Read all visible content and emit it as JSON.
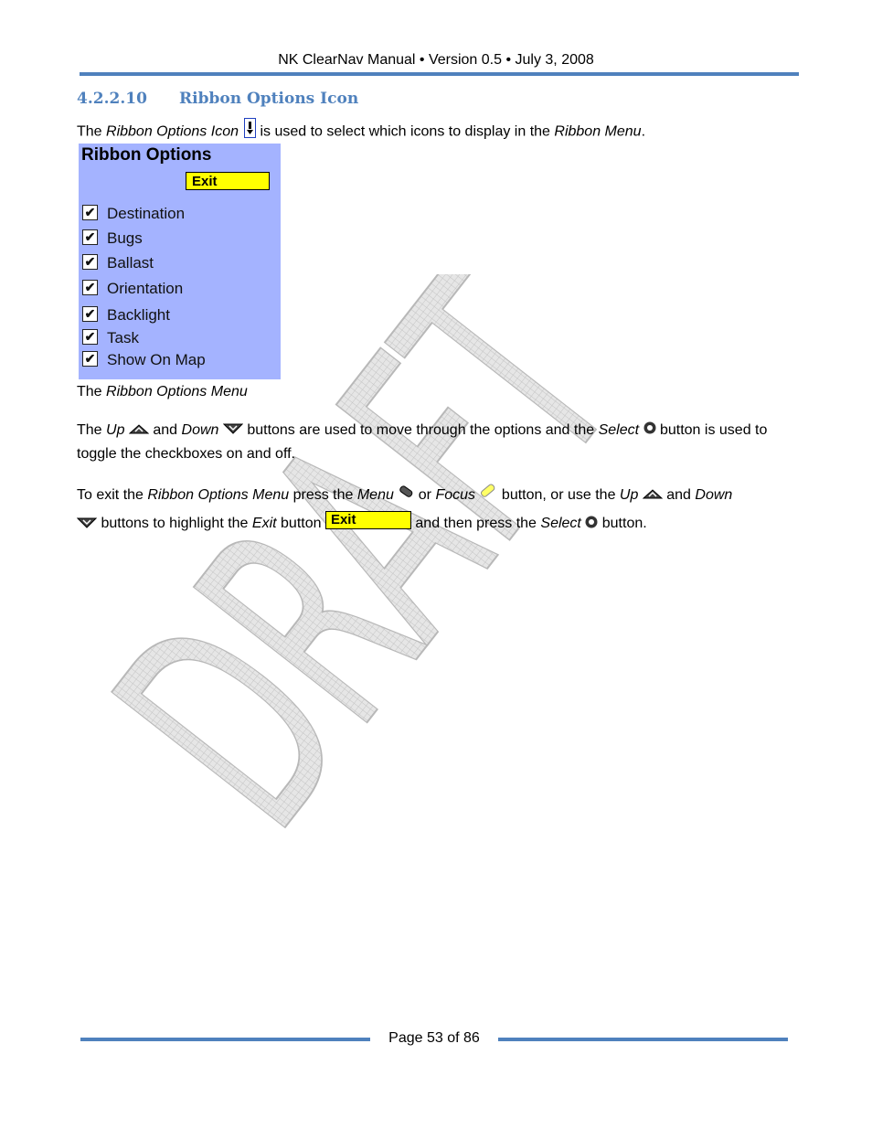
{
  "header": {
    "title": "NK ClearNav Manual • Version 0.5 • July 3, 2008"
  },
  "section": {
    "number": "4.2.2.10",
    "title": "Ribbon Options Icon"
  },
  "intro": {
    "t1": "The ",
    "i1": "Ribbon Options Icon",
    "t2": " is used to select which icons to display in the ",
    "i2": "Ribbon Menu",
    "t3": "."
  },
  "ribbon_panel": {
    "title": "Ribbon Options",
    "exit_label": "Exit",
    "options": [
      {
        "label": "Destination",
        "checked": true
      },
      {
        "label": "Bugs",
        "checked": true
      },
      {
        "label": "Ballast",
        "checked": true
      },
      {
        "label": "Orientation",
        "checked": true
      },
      {
        "label": "Backlight",
        "checked": true
      },
      {
        "label": "Task",
        "checked": true
      },
      {
        "label": "Show On Map",
        "checked": true
      }
    ],
    "check_glyph": "✔",
    "bg_color": "#a4b3ff"
  },
  "caption": {
    "t1": "The ",
    "i1": "Ribbon Options Menu"
  },
  "para1": {
    "t1": "The ",
    "i1": "Up",
    "t2": " and ",
    "i2": "Down",
    "t3": " buttons are used to move through the options and the ",
    "i3": "Select",
    "t4": " button is used to toggle the checkboxes on and off."
  },
  "para2": {
    "t1": "To exit the ",
    "i1": "Ribbon Options Menu",
    "t2": " press the ",
    "i2": "Menu",
    "t3": " or ",
    "i3": "Focus",
    "t4": " button, or use the ",
    "i4": "Up",
    "t5": " and ",
    "i5": "Down",
    "t6": " buttons to highlight the ",
    "i6": "Exit",
    "t7": " button ",
    "exit_label": "Exit",
    "t8": " and then press the ",
    "i7": "Select",
    "t9": " button."
  },
  "watermark": {
    "text": "DRAFT"
  },
  "footer": {
    "page": "Page 53 of 86"
  },
  "colors": {
    "accent": "#4f81bd",
    "exit_yellow": "#ffff00"
  }
}
